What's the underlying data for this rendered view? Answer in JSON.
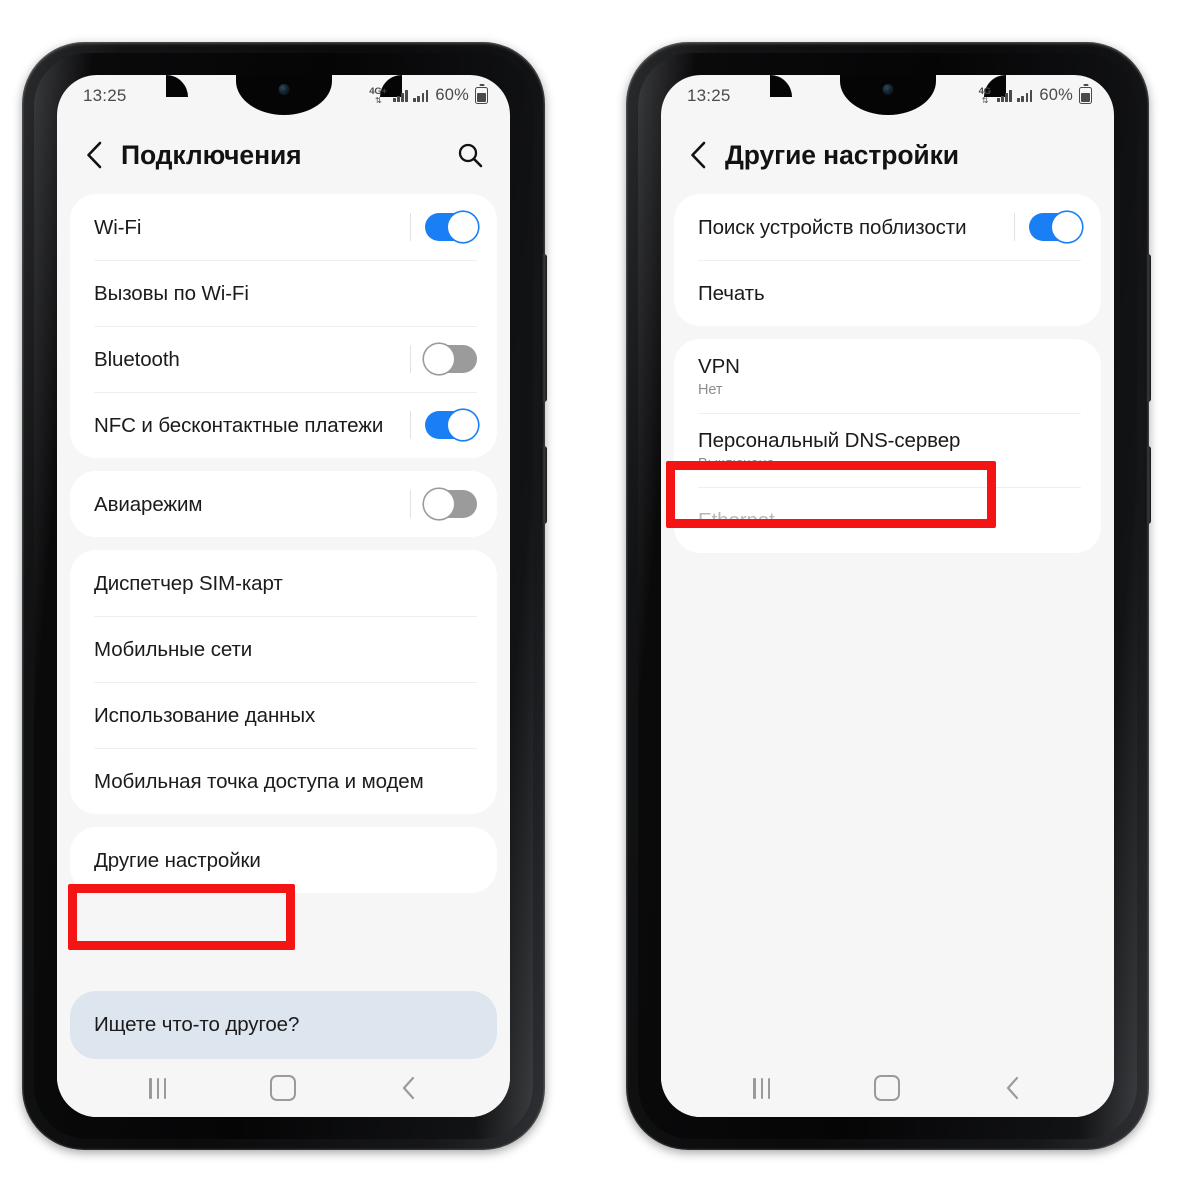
{
  "phones": [
    {
      "id": "connections",
      "status_bar": {
        "time": "13:25",
        "network": "4G+",
        "data_arrows": "⇅",
        "battery_percent": "60%"
      },
      "header": {
        "title": "Подключения",
        "back_icon": "chevron-left-icon",
        "search_icon": "search-icon",
        "has_search": true
      },
      "groups": [
        {
          "rows": [
            {
              "title": "Wi-Fi",
              "sub": "",
              "control": "toggle",
              "toggle_state": "on"
            },
            {
              "title": "Вызовы по Wi-Fi",
              "sub": "",
              "control": "none",
              "toggle_state": ""
            },
            {
              "title": "Bluetooth",
              "sub": "",
              "control": "toggle",
              "toggle_state": "off"
            },
            {
              "title": "NFC и бесконтактные платежи",
              "sub": "",
              "control": "toggle",
              "toggle_state": "on"
            }
          ]
        },
        {
          "rows": [
            {
              "title": "Авиарежим",
              "sub": "",
              "control": "toggle",
              "toggle_state": "off"
            }
          ]
        },
        {
          "rows": [
            {
              "title": "Диспетчер SIM-карт",
              "sub": "",
              "control": "none",
              "toggle_state": ""
            },
            {
              "title": "Мобильные сети",
              "sub": "",
              "control": "none",
              "toggle_state": ""
            },
            {
              "title": "Использование данных",
              "sub": "",
              "control": "none",
              "toggle_state": ""
            },
            {
              "title": "Мобильная точка доступа и модем",
              "sub": "",
              "control": "none",
              "toggle_state": ""
            }
          ]
        },
        {
          "rows": [
            {
              "title": "Другие настройки",
              "sub": "",
              "control": "none",
              "toggle_state": "",
              "highlighted": true
            }
          ]
        }
      ],
      "banner": {
        "label": "Ищете что-то другое?"
      },
      "navbar": {
        "recents_icon": "recents-icon",
        "home_icon": "home-icon",
        "back_icon": "back-chevron-icon"
      }
    },
    {
      "id": "more-settings",
      "status_bar": {
        "time": "13:25",
        "network": "4G",
        "data_arrows": "⇅",
        "battery_percent": "60%"
      },
      "header": {
        "title": "Другие настройки",
        "back_icon": "chevron-left-icon",
        "search_icon": "",
        "has_search": false
      },
      "groups": [
        {
          "rows": [
            {
              "title": "Поиск устройств поблизости",
              "sub": "",
              "control": "toggle",
              "toggle_state": "on"
            },
            {
              "title": "Печать",
              "sub": "",
              "control": "none",
              "toggle_state": ""
            }
          ]
        },
        {
          "rows": [
            {
              "title": "VPN",
              "sub": "Нет",
              "control": "none",
              "toggle_state": ""
            },
            {
              "title": "Персональный DNS-сервер",
              "sub": "Выключено",
              "control": "none",
              "toggle_state": "",
              "highlighted": true
            },
            {
              "title": "Ethernet",
              "sub": "",
              "control": "none",
              "toggle_state": "",
              "disabled": true
            }
          ]
        }
      ],
      "banner": null,
      "navbar": {
        "recents_icon": "recents-icon",
        "home_icon": "home-icon",
        "back_icon": "back-chevron-icon"
      }
    }
  ],
  "annotations": {
    "accent_color": "#f51414",
    "boxes": [
      {
        "target": "Другие настройки",
        "phone": "connections"
      },
      {
        "target": "Персональный DNS-сервер",
        "phone": "more-settings"
      }
    ]
  },
  "colors": {
    "toggle_on": "#1a7ef5",
    "toggle_off": "#9b9b9b",
    "screen_bg": "#f6f6f6",
    "card_bg": "#ffffff",
    "banner_bg": "#dde5ee",
    "title_text": "#121212",
    "sub_text": "#8d8d8d",
    "disabled_text": "#b8b8b8",
    "annotation_red": "#f51414",
    "phone_frame": "#0b0b0c"
  }
}
